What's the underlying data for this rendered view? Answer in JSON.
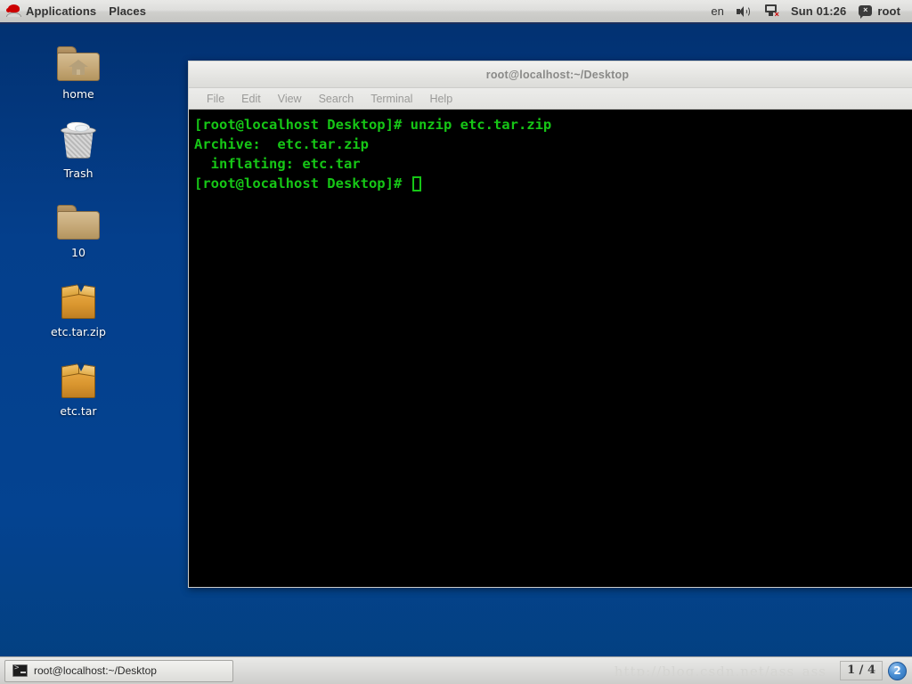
{
  "top_panel": {
    "logo_icon": "redhat-logo-icon",
    "menus": [
      {
        "label": "Applications",
        "name": "applications-menu"
      },
      {
        "label": "Places",
        "name": "places-menu"
      }
    ],
    "keyboard_layout": "en",
    "volume_icon": "volume-icon",
    "network_icon": "network-disconnected-icon",
    "clock": "Sun 01:26",
    "message_icon": "message-icon",
    "user": "root"
  },
  "desktop": {
    "background_color": "#043f8c",
    "icons": [
      {
        "label": "home",
        "icon": "home-folder-icon",
        "type": "folder-home"
      },
      {
        "label": "Trash",
        "icon": "trash-icon",
        "type": "trash"
      },
      {
        "label": "10",
        "icon": "folder-icon",
        "type": "folder"
      },
      {
        "label": "etc.tar.zip",
        "icon": "archive-icon",
        "type": "archive"
      },
      {
        "label": "etc.tar",
        "icon": "archive-icon",
        "type": "archive"
      }
    ]
  },
  "terminal": {
    "title": "root@localhost:~/Desktop",
    "menu": [
      "File",
      "Edit",
      "View",
      "Search",
      "Terminal",
      "Help"
    ],
    "background_color": "#000000",
    "text_color": "#16c616",
    "lines": [
      "[root@localhost Desktop]# unzip etc.tar.zip",
      "Archive:  etc.tar.zip",
      "  inflating: etc.tar",
      "[root@localhost Desktop]# "
    ],
    "prompt": "[root@localhost Desktop]# ",
    "cursor": "block-outline"
  },
  "bottom_panel": {
    "task_button": {
      "label": "root@localhost:~/Desktop",
      "icon": "terminal-icon"
    },
    "watermark": "http://blog.csdn.net/ass_ass",
    "workspace": {
      "label": "1 / 4",
      "badge": "2"
    }
  }
}
